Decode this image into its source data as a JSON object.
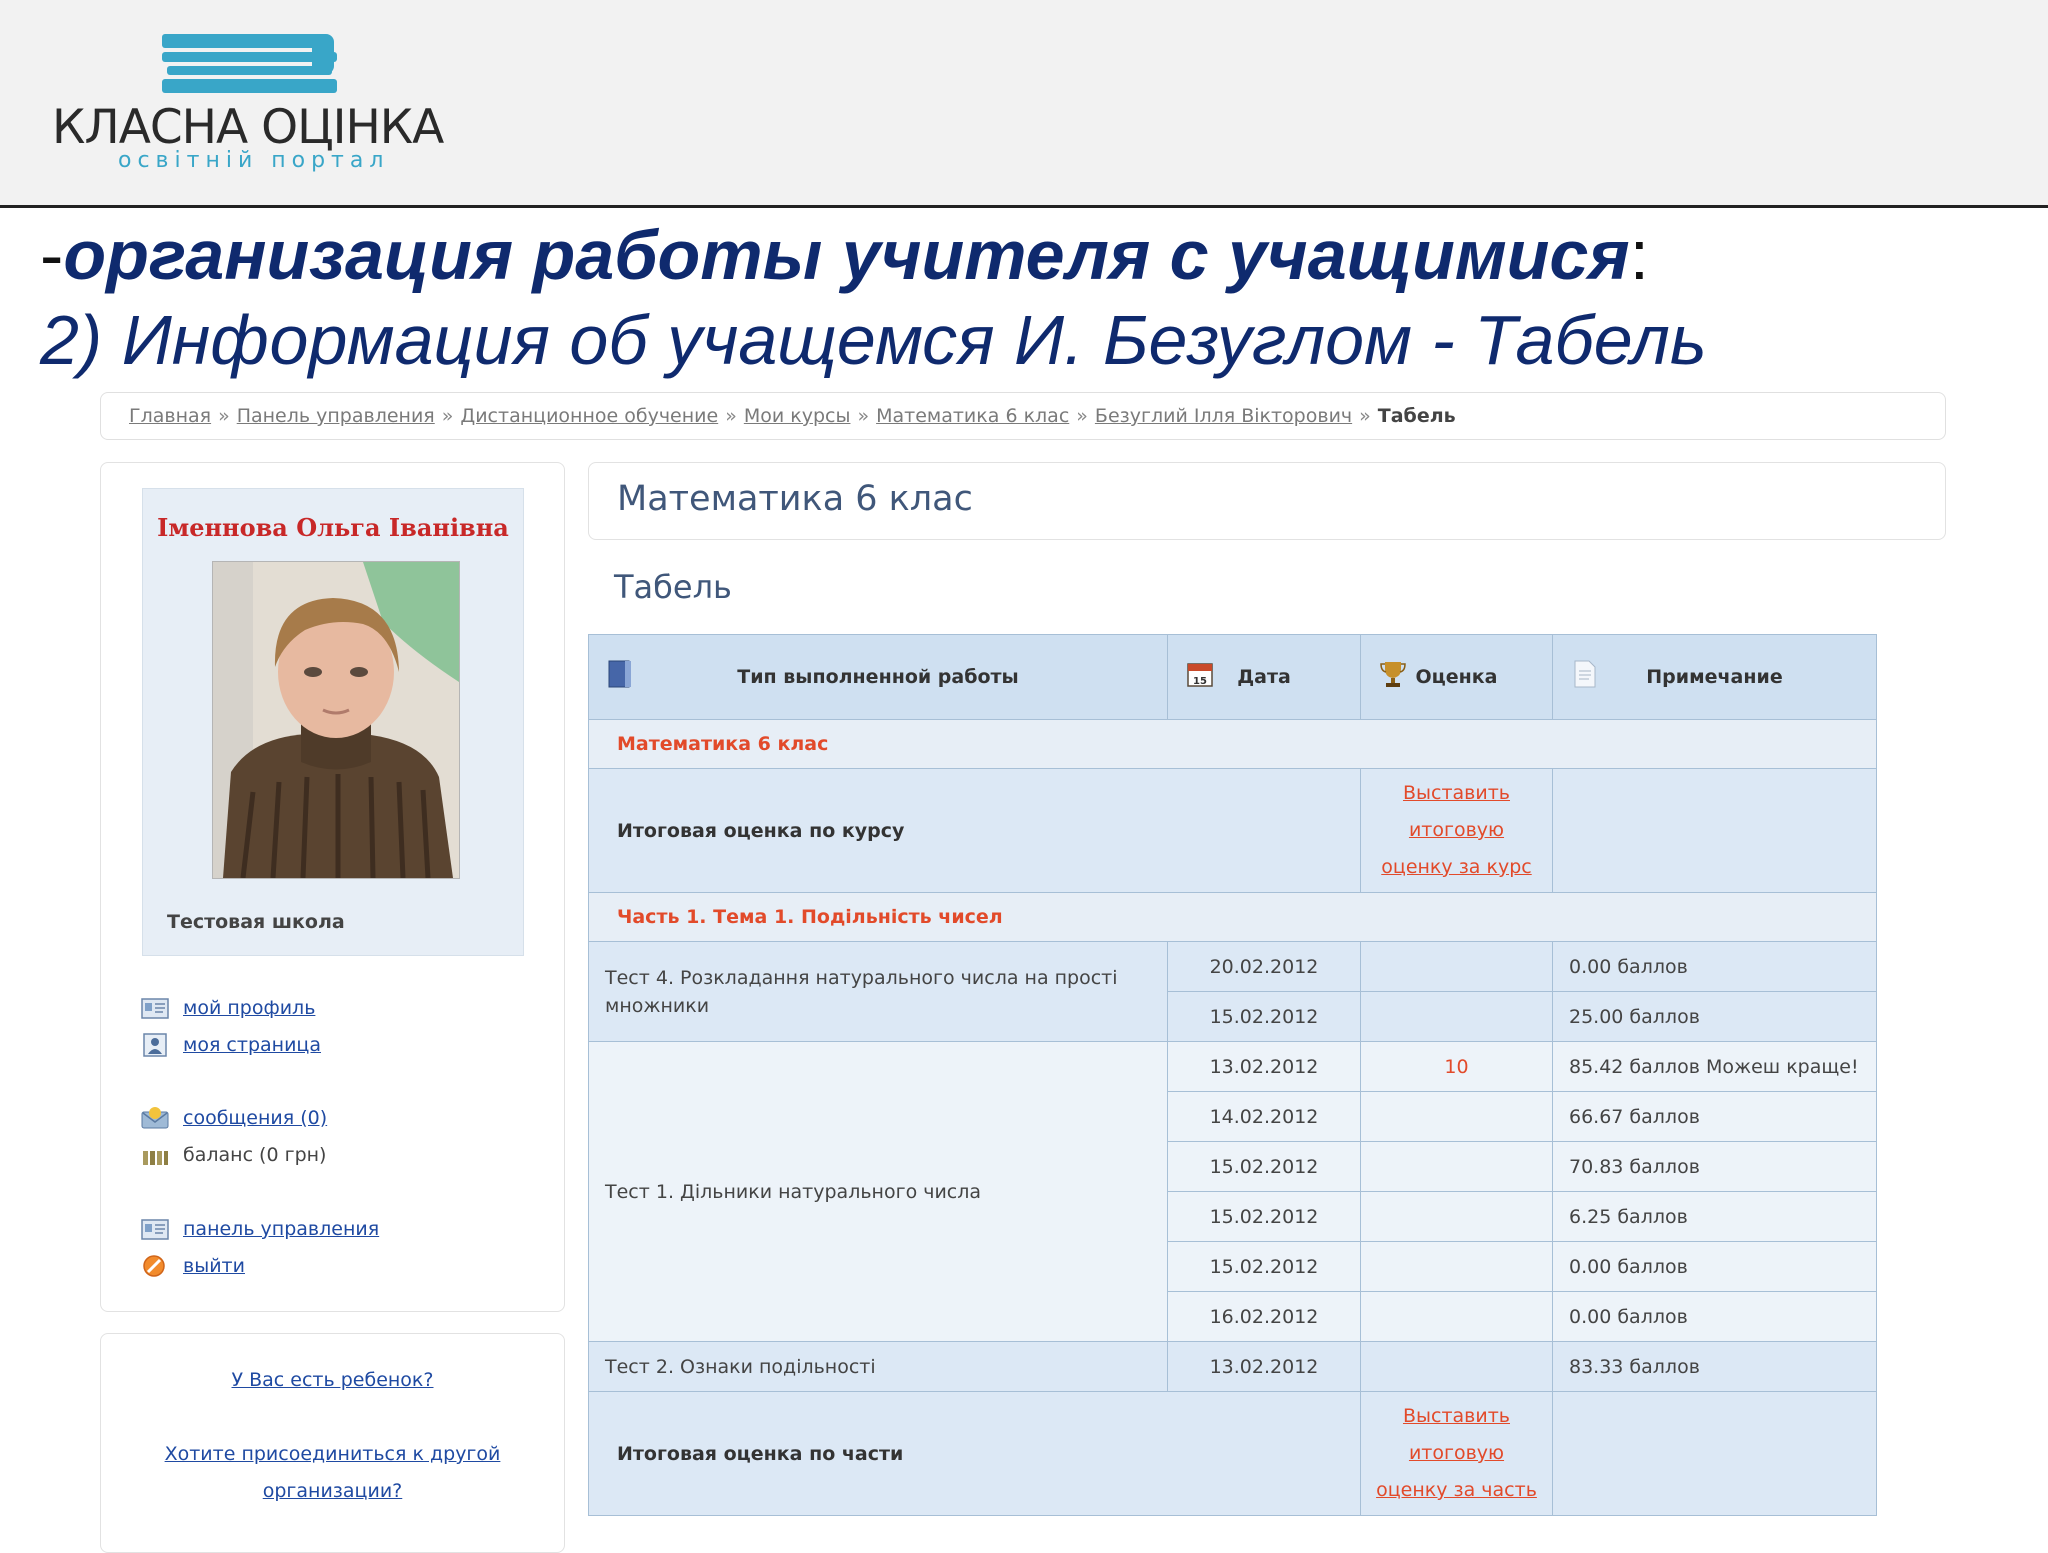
{
  "logo": {
    "title": "КЛАСНА ОЦІНКА",
    "subtitle": "освітній портал"
  },
  "slide": {
    "title_prefix": "-",
    "title_main": "организация работы учителя с учащимися",
    "title_suffix": ":",
    "subtitle": "2) Информация об учащемся И. Безуглом - Табель"
  },
  "breadcrumb": {
    "links": [
      "Главная",
      "Панель управления",
      "Дистанционное обучение",
      "Мои курсы",
      "Математика 6 клас",
      "Безуглий Ілля Вікторович"
    ],
    "current": "Табель",
    "separator": "»"
  },
  "profile": {
    "name": "Іменнова Ольга Іванівна",
    "school": "Тестовая школа"
  },
  "menu": {
    "my_profile": "мой профиль",
    "my_page": "моя страница",
    "messages": "сообщения (0)",
    "balance": "баланс (0 грн)",
    "control_panel": "панель управления",
    "logout": "выйти"
  },
  "child_box": {
    "have_child": "У Вас есть ребенок?",
    "join_line1": "Хотите присоединиться к другой",
    "join_line2": "организации?"
  },
  "course": {
    "title": "Математика 6 клас",
    "section_title": "Табель"
  },
  "table": {
    "headers": {
      "work_type": "Тип выполненной работы",
      "date": "Дата",
      "grade": "Оценка",
      "note": "Примечание"
    },
    "course_section": "Математика 6 клас",
    "course_final_label": "Итоговая оценка по курсу",
    "course_final_action": [
      "Выставить",
      "итоговую",
      "оценку за курс"
    ],
    "part_section": "Часть 1. Тема 1. Подільність чисел",
    "test4_name": "Тест 4. Розкладання натурального числа на прості множники",
    "test4_rows": [
      {
        "date": "20.02.2012",
        "grade": "",
        "note": "0.00 баллов"
      },
      {
        "date": "15.02.2012",
        "grade": "",
        "note": "25.00 баллов"
      }
    ],
    "test1_name": "Тест 1. Дільники натурального числа",
    "test1_rows": [
      {
        "date": "13.02.2012",
        "grade": "10",
        "note": "85.42 баллов Можеш краще!"
      },
      {
        "date": "14.02.2012",
        "grade": "",
        "note": "66.67 баллов"
      },
      {
        "date": "15.02.2012",
        "grade": "",
        "note": "70.83 баллов"
      },
      {
        "date": "15.02.2012",
        "grade": "",
        "note": "6.25 баллов"
      },
      {
        "date": "15.02.2012",
        "grade": "",
        "note": "0.00 баллов"
      },
      {
        "date": "16.02.2012",
        "grade": "",
        "note": "0.00 баллов"
      }
    ],
    "test2_name": "Тест 2. Ознаки подільності",
    "test2_row": {
      "date": "13.02.2012",
      "grade": "",
      "note": "83.33 баллов"
    },
    "part_final_label": "Итоговая оценка по части",
    "part_final_action": [
      "Выставить",
      "итоговую",
      "оценку за часть"
    ]
  },
  "colors": {
    "title_blue": "#0f2a6e",
    "accent_red": "#e24a2a",
    "table_header": "#cfe0f1",
    "link_blue": "#1f4aa2",
    "logo_cyan": "#39a6c8"
  },
  "icons": {
    "work_type": "book-icon",
    "date": "calendar-icon",
    "grade": "trophy-icon",
    "note": "document-icon",
    "menu": [
      "profile-card-icon",
      "user-page-icon",
      "envelope-icon",
      "balance-icon",
      "control-panel-icon",
      "logout-icon"
    ]
  }
}
